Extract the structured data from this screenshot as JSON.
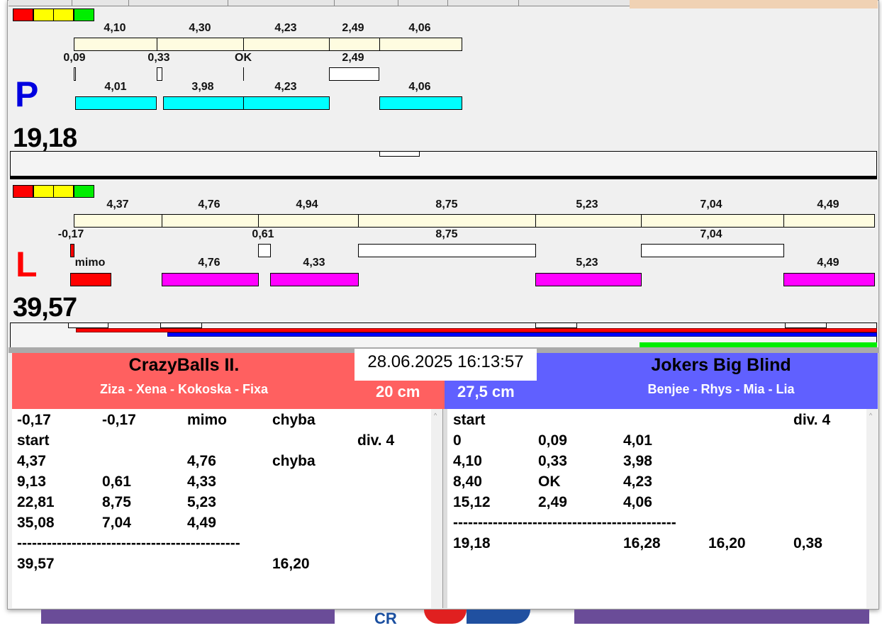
{
  "colors": {
    "red": "#ff0000",
    "yellow": "#ffff00",
    "green": "#00e000",
    "cyan": "#00ffff",
    "magenta": "#ff00ff",
    "team_left": "#ff6060",
    "team_right": "#6060ff"
  },
  "p": {
    "letter": "P",
    "total": "19,18",
    "row1": [
      "4,10",
      "4,30",
      "4,23",
      "2,49",
      "4,06"
    ],
    "row2": [
      "0,09",
      "0,33",
      "OK",
      "2,49"
    ],
    "row3": [
      "4,01",
      "3,98",
      "4,23",
      "4,06"
    ]
  },
  "l": {
    "letter": "L",
    "total": "39,57",
    "row1": [
      "4,37",
      "4,76",
      "4,94",
      "8,75",
      "5,23",
      "7,04",
      "4,49"
    ],
    "row2": [
      "-0,17",
      "0,61",
      "8,75",
      "7,04"
    ],
    "row3": [
      "mimo",
      "4,76",
      "4,33",
      "5,23",
      "4,49"
    ]
  },
  "datetime": "28.06.2025 16:13:57",
  "left_team": {
    "name": "CrazyBalls II.",
    "players": "Ziza - Xena - Kokoska - Fixa",
    "distance": "20 cm",
    "rows": [
      [
        "-0,17",
        "-0,17",
        "mimo",
        "chyba",
        ""
      ],
      [
        "start",
        "",
        "",
        "",
        "div.  4"
      ],
      [
        "4,37",
        "",
        "4,76",
        "chyba",
        ""
      ],
      [
        "9,13",
        "0,61",
        "4,33",
        "",
        ""
      ],
      [
        "22,81",
        "8,75",
        "5,23",
        "",
        ""
      ],
      [
        "35,08",
        "7,04",
        "4,49",
        "",
        ""
      ],
      [
        "---------------------------------------------",
        "",
        "",
        "",
        ""
      ],
      [
        "39,57",
        "",
        "",
        "16,20",
        ""
      ]
    ]
  },
  "right_team": {
    "name": "Jokers Big Blind",
    "players": "Benjee - Rhys - Mia - Lia",
    "distance": "27,5 cm",
    "rows": [
      [
        "start",
        "",
        "",
        "",
        "div.  4"
      ],
      [
        "0",
        "0,09",
        "4,01",
        "",
        ""
      ],
      [
        "4,10",
        "0,33",
        "3,98",
        "",
        ""
      ],
      [
        "8,40",
        "OK",
        "4,23",
        "",
        ""
      ],
      [
        "15,12",
        "2,49",
        "4,06",
        "",
        ""
      ],
      [
        "---------------------------------------------",
        "",
        "",
        "",
        ""
      ],
      [
        "19,18",
        "",
        "16,28",
        "16,20",
        "0,38"
      ]
    ]
  }
}
